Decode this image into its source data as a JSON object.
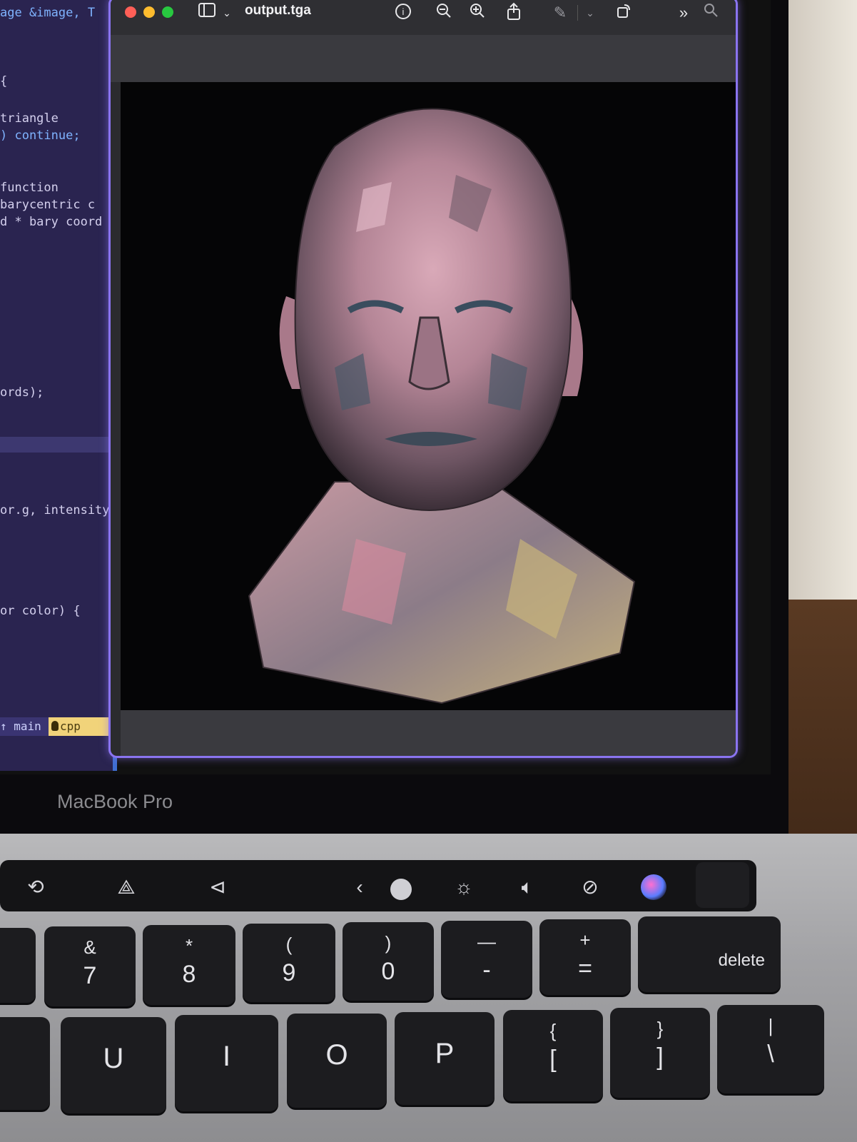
{
  "editor": {
    "lines": [
      {
        "text": "age &image, T",
        "kind": "kw"
      },
      {
        "text": "{",
        "kind": "plain"
      },
      {
        "text": "triangle",
        "kind": "plain"
      },
      {
        "text": ") continue;",
        "kind": "kw"
      },
      {
        "text": "function",
        "kind": "plain"
      },
      {
        "text": "barycentric c",
        "kind": "plain"
      },
      {
        "text": "d * bary coord",
        "kind": "plain"
      },
      {
        "text": "ords);",
        "kind": "plain"
      },
      {
        "text": "or.g, intensity",
        "kind": "plain"
      },
      {
        "text": "or color) {",
        "kind": "plain"
      }
    ],
    "status": {
      "branch": "main",
      "language": "cpp"
    }
  },
  "window": {
    "title": "output.tga",
    "toolbar_icons": [
      "sidebar-icon",
      "chevron-down-icon",
      "info-icon",
      "zoom-out-icon",
      "zoom-in-icon",
      "share-icon",
      "markup-pen-icon",
      "chevron-down-icon",
      "rotate-icon",
      "more-icon",
      "search-icon"
    ]
  },
  "laptop": {
    "brand": "MacBook Pro",
    "touch_bar_icons": [
      "rotate-icon",
      "triangle-icon",
      "flag-icon",
      "collapse-left-icon",
      "siri-bars-icon",
      "brightness-icon",
      "volume-icon",
      "mute-icon",
      "siri-icon"
    ],
    "keys": [
      {
        "top": "&",
        "bottom": "7"
      },
      {
        "top": "*",
        "bottom": "8"
      },
      {
        "top": "(",
        "bottom": "9"
      },
      {
        "top": ")",
        "bottom": "0"
      },
      {
        "top": "—",
        "bottom": "-"
      },
      {
        "top": "+",
        "bottom": "="
      },
      {
        "label": "delete"
      }
    ],
    "letter_keys": [
      "U",
      "I",
      "O",
      "P"
    ],
    "bracket_keys": [
      {
        "top": "{",
        "bottom": "["
      },
      {
        "top": "}",
        "bottom": "]"
      },
      {
        "top": "|",
        "bottom": "\\"
      }
    ]
  }
}
